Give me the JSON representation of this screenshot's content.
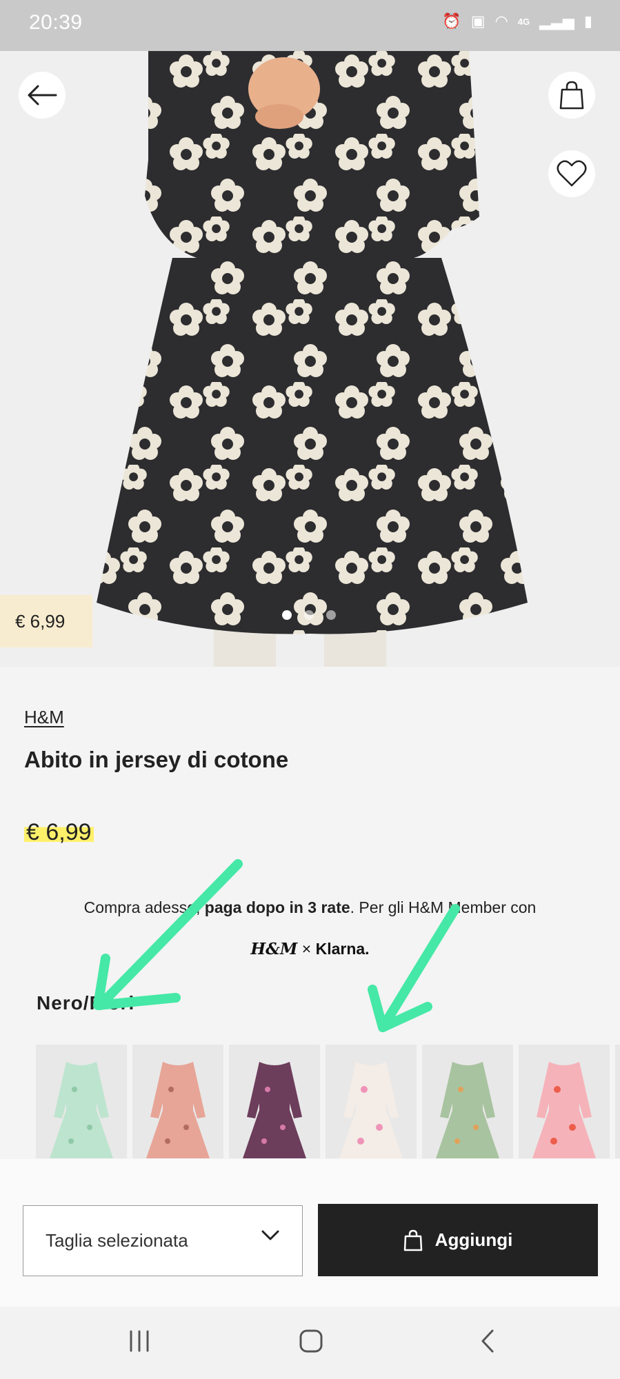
{
  "status_bar": {
    "time": "20:39",
    "icons": [
      "alarm-icon",
      "notification-icon",
      "wifi-icon",
      "network-4g-icon",
      "signal-icon",
      "battery-icon"
    ],
    "network_label": "4G"
  },
  "hero": {
    "price": "€ 6,99",
    "carousel_pages": 3,
    "carousel_active": 1
  },
  "product": {
    "brand": "H&M",
    "title": "Abito in jersey di cotone",
    "price": "€ 6,99",
    "price_highlight_color": "#fff06a"
  },
  "klarna": {
    "text_part1": "Compra adesso, ",
    "text_bold_a": "paga dopo in 3 rate",
    "text_part2": ". Per gli H&M Member con",
    "logo_hm": "H&M",
    "logo_sep": "×",
    "logo_klarna": "Klarna."
  },
  "color": {
    "name": "Nero/Fiori"
  },
  "swatches": [
    {
      "name": "verde menta fiori",
      "bg": "#bde4cf",
      "pattern": "#8fc9a7"
    },
    {
      "name": "rosa antico fiori",
      "bg": "#e7a597",
      "pattern": "#b26d5f"
    },
    {
      "name": "viola fiori",
      "bg": "#6d3d5c",
      "pattern": "#d67aa7"
    },
    {
      "name": "bianco cuori",
      "bg": "#f4ece6",
      "pattern": "#ef93b8"
    },
    {
      "name": "verde salvia fiori",
      "bg": "#a8c3a0",
      "pattern": "#e0a25a"
    },
    {
      "name": "rosa fiori",
      "bg": "#f6b2b9",
      "pattern": "#ec5d4c"
    }
  ],
  "actions": {
    "size_select_label": "Taglia selezionata",
    "add_label": "Aggiungi"
  },
  "colors": {
    "button_dark": "#222222",
    "annotation_arrow": "#45e8a6"
  }
}
